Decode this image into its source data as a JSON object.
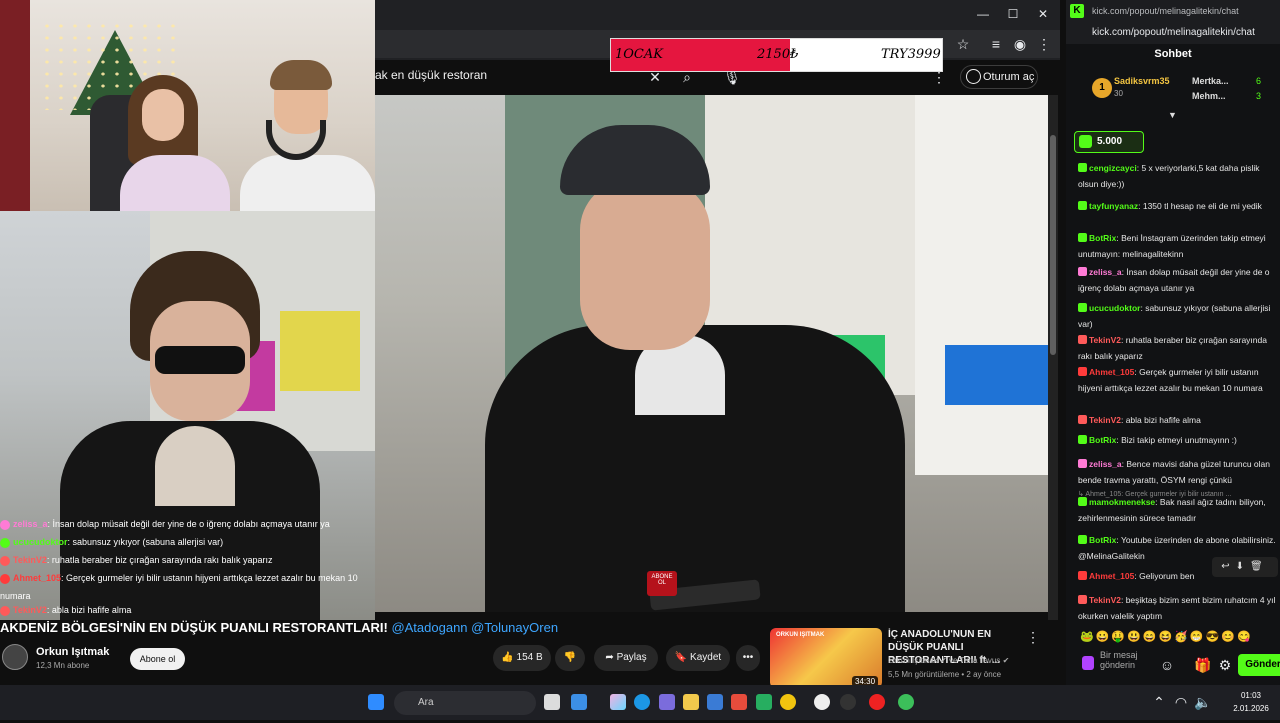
{
  "browser": {
    "search_query": "ak en düşük restoran",
    "signin_label": "Oturum aç"
  },
  "overlay": {
    "left_text": "1OCAK",
    "mid_text": "2150₺",
    "right_text": "TRY3999",
    "progress": 0.54,
    "fill_color": "#e5163f"
  },
  "overlay_chat": [
    {
      "user": "zeliss_a",
      "text": ": İnsan dolap müsait değil der yine de o iğrenç dolabı açmaya utanır ya",
      "color": "#ff7bd5"
    },
    {
      "user": "ucucudoktor",
      "text": ": sabunsuz yıkıyor (sabuna allerjisi var)",
      "color": "#53fc18"
    },
    {
      "user": "TekinV2",
      "text": ": ruhatla beraber biz çırağan sarayında rakı balık yaparız",
      "color": "#ff5a5a"
    },
    {
      "user": "Ahmet_105",
      "text": ": Gerçek gurmeler iyi bilir ustanın hijyeni arttıkça lezzet azalır bu mekan 10",
      "color": "#ff3b3b"
    },
    {
      "user": "",
      "text": "numara",
      "color": "#ffffff"
    },
    {
      "user": "TekinV2",
      "text": ": abla bizi hafife alma",
      "color": "#ff5a5a"
    },
    {
      "user": "BotRix",
      "text": ": Bizi takip etmeyi unutmayınn :)",
      "color": "#53fc18"
    },
    {
      "user": "zeliss_a",
      "text": ": Bence mavisi daha güzel turuncu olan bende travma yarattı, ÖSYM rengi çünkü",
      "color": "#ff7bd5"
    },
    {
      "user": "mamokmenekse",
      "text": ": Bak nasıl ağız tadını biliyon, zehirlenmesinin sürece tamadır",
      "color": "#53fc18"
    },
    {
      "user": "BotRix",
      "text": ": Youtube üzerinden de abone olabilirsiniz. @MelinaGalitekin",
      "color": "#53fc18"
    },
    {
      "user": "Ahmet_105",
      "text": ": Geliyorum ben",
      "color": "#ff3b3b"
    },
    {
      "user": "TekinV2",
      "text": ": beşiktaş bizim semt bizim ruhatcım 4 yıl okurken valelik yaptım",
      "color": "#ff5a5a"
    }
  ],
  "video": {
    "title": "AKDENİZ BÖLGESİ'NİN EN DÜŞÜK PUANLI RESTORANTLARI!",
    "mentions": "@Atadogann @TolunayOren",
    "channel_name": "Orkun Işıtmak",
    "subscribers": "12,3 Mn abone",
    "subscribe_label": "Abone ol",
    "likes": "154 B",
    "share_label": "Paylaş",
    "save_label": "Kaydet",
    "more_label": "•••",
    "abone_badge": "ABONE OL"
  },
  "recommendation": {
    "title": "İÇ ANADOLU'NUN EN DÜŞÜK PUANLI RESTORANTLARI! ft. ...",
    "channel": "Orkun Işıtmak ✔ ve Tuna Tavus ✔",
    "meta": "5,5 Mn görüntüleme • 2 ay önce",
    "duration": "34:30",
    "thumb_text": "ORKUN IŞITMAK"
  },
  "kick": {
    "tab_url": "kick.com/popout/melinagalitekin/chat",
    "url": "kick.com/popout/melinagalitekin/chat",
    "heading": "Sohbet",
    "top_gifters": [
      {
        "name": "Sadiksvrm35",
        "count": "30"
      },
      {
        "name": "Mertka...",
        "count": "6"
      },
      {
        "name": "Mehm...",
        "count": "3"
      }
    ],
    "gift_amount": "5.000",
    "messages": [
      {
        "user": "cengizcayci",
        "text": ": 5 x veriyorlarki,5 kat daha pislik olsun diye:))",
        "color": "#53fc18"
      },
      {
        "user": "tayfunyanaz",
        "text": ": 1350 tl hesap ne eli de mi yedik",
        "color": "#53fc18"
      },
      {
        "user": "BotRix",
        "text": ": Beni İnstagram üzerinden takip etmeyi unutmayın: melinagalitekinn",
        "color": "#53fc18"
      },
      {
        "user": "zeliss_a",
        "text": ": İnsan dolap müsait değil der yine de o iğrenç dolabı açmaya utanır ya",
        "color": "#ff7bd5"
      },
      {
        "user": "ucucudoktor",
        "text": ": sabunsuz yıkıyor (sabuna allerjisi var)",
        "color": "#53fc18"
      },
      {
        "user": "TekinV2",
        "text": ": ruhatla beraber biz çırağan sarayında rakı balık yaparız",
        "color": "#ff5a5a"
      },
      {
        "user": "Ahmet_105",
        "text": ": Gerçek gurmeler iyi bilir ustanın hijyeni arttıkça lezzet azalır bu mekan 10 numara",
        "color": "#ff3b3b"
      },
      {
        "user": "TekinV2",
        "text": ": abla bizi hafife alma",
        "color": "#ff5a5a"
      },
      {
        "user": "BotRix",
        "text": ": Bizi takip etmeyi unutmayınn :)",
        "color": "#53fc18"
      },
      {
        "user": "zeliss_a",
        "text": ": Bence mavisi daha güzel turuncu olan bende travma yarattı, ÖSYM rengi çünkü",
        "color": "#ff7bd5"
      },
      {
        "user": "mamokmenekse",
        "text": ": Bak nasıl ağız tadını biliyon, zehirlenmesinin sürece tamadır",
        "color": "#53fc18"
      },
      {
        "user": "BotRix",
        "text": ": Youtube üzerinden de abone olabilirsiniz. @MelinaGalitekin",
        "color": "#53fc18"
      },
      {
        "user": "Ahmet_105",
        "text": ": Geliyorum ben",
        "color": "#ff3b3b"
      },
      {
        "user": "TekinV2",
        "text": ": beşiktaş bizim semt bizim ruhatcım 4 yıl okurken valelik yaptım",
        "color": "#ff5a5a"
      }
    ],
    "reply_preview": "↳ Ahmet_105: Gerçek gurmeler iyi bilir ustanın ...",
    "input_placeholder": "Bir mesaj gönderin",
    "send_label": "Gönder"
  },
  "taskbar": {
    "search_placeholder": "Ara",
    "time": "01:03",
    "date": "2.01.2026"
  }
}
